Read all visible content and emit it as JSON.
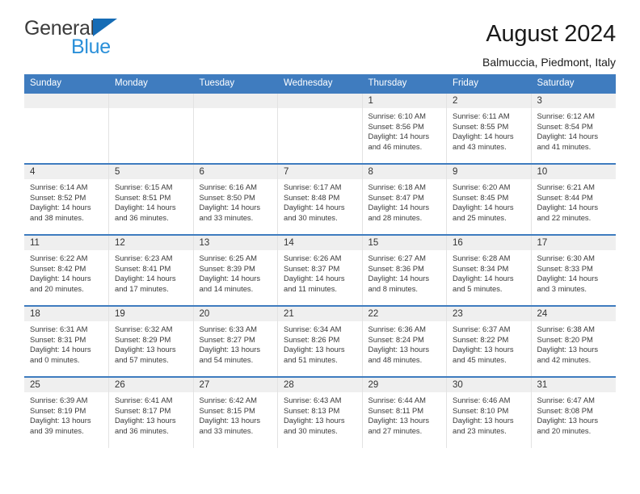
{
  "brand": {
    "line1": "General",
    "line2": "Blue",
    "triangle_color": "#166cb5",
    "blue_color": "#2b90d9"
  },
  "header": {
    "title": "August 2024",
    "subtitle": "Balmuccia, Piedmont, Italy"
  },
  "theme": {
    "header_blue": "#3f7cbf",
    "daynum_bg": "#efefef",
    "text": "#333333"
  },
  "weekdays": [
    "Sunday",
    "Monday",
    "Tuesday",
    "Wednesday",
    "Thursday",
    "Friday",
    "Saturday"
  ],
  "weeks": [
    [
      {
        "day": "",
        "sunrise": "",
        "sunset": "",
        "daylight1": "",
        "daylight2": ""
      },
      {
        "day": "",
        "sunrise": "",
        "sunset": "",
        "daylight1": "",
        "daylight2": ""
      },
      {
        "day": "",
        "sunrise": "",
        "sunset": "",
        "daylight1": "",
        "daylight2": ""
      },
      {
        "day": "",
        "sunrise": "",
        "sunset": "",
        "daylight1": "",
        "daylight2": ""
      },
      {
        "day": "1",
        "sunrise": "Sunrise: 6:10 AM",
        "sunset": "Sunset: 8:56 PM",
        "daylight1": "Daylight: 14 hours",
        "daylight2": "and 46 minutes."
      },
      {
        "day": "2",
        "sunrise": "Sunrise: 6:11 AM",
        "sunset": "Sunset: 8:55 PM",
        "daylight1": "Daylight: 14 hours",
        "daylight2": "and 43 minutes."
      },
      {
        "day": "3",
        "sunrise": "Sunrise: 6:12 AM",
        "sunset": "Sunset: 8:54 PM",
        "daylight1": "Daylight: 14 hours",
        "daylight2": "and 41 minutes."
      }
    ],
    [
      {
        "day": "4",
        "sunrise": "Sunrise: 6:14 AM",
        "sunset": "Sunset: 8:52 PM",
        "daylight1": "Daylight: 14 hours",
        "daylight2": "and 38 minutes."
      },
      {
        "day": "5",
        "sunrise": "Sunrise: 6:15 AM",
        "sunset": "Sunset: 8:51 PM",
        "daylight1": "Daylight: 14 hours",
        "daylight2": "and 36 minutes."
      },
      {
        "day": "6",
        "sunrise": "Sunrise: 6:16 AM",
        "sunset": "Sunset: 8:50 PM",
        "daylight1": "Daylight: 14 hours",
        "daylight2": "and 33 minutes."
      },
      {
        "day": "7",
        "sunrise": "Sunrise: 6:17 AM",
        "sunset": "Sunset: 8:48 PM",
        "daylight1": "Daylight: 14 hours",
        "daylight2": "and 30 minutes."
      },
      {
        "day": "8",
        "sunrise": "Sunrise: 6:18 AM",
        "sunset": "Sunset: 8:47 PM",
        "daylight1": "Daylight: 14 hours",
        "daylight2": "and 28 minutes."
      },
      {
        "day": "9",
        "sunrise": "Sunrise: 6:20 AM",
        "sunset": "Sunset: 8:45 PM",
        "daylight1": "Daylight: 14 hours",
        "daylight2": "and 25 minutes."
      },
      {
        "day": "10",
        "sunrise": "Sunrise: 6:21 AM",
        "sunset": "Sunset: 8:44 PM",
        "daylight1": "Daylight: 14 hours",
        "daylight2": "and 22 minutes."
      }
    ],
    [
      {
        "day": "11",
        "sunrise": "Sunrise: 6:22 AM",
        "sunset": "Sunset: 8:42 PM",
        "daylight1": "Daylight: 14 hours",
        "daylight2": "and 20 minutes."
      },
      {
        "day": "12",
        "sunrise": "Sunrise: 6:23 AM",
        "sunset": "Sunset: 8:41 PM",
        "daylight1": "Daylight: 14 hours",
        "daylight2": "and 17 minutes."
      },
      {
        "day": "13",
        "sunrise": "Sunrise: 6:25 AM",
        "sunset": "Sunset: 8:39 PM",
        "daylight1": "Daylight: 14 hours",
        "daylight2": "and 14 minutes."
      },
      {
        "day": "14",
        "sunrise": "Sunrise: 6:26 AM",
        "sunset": "Sunset: 8:37 PM",
        "daylight1": "Daylight: 14 hours",
        "daylight2": "and 11 minutes."
      },
      {
        "day": "15",
        "sunrise": "Sunrise: 6:27 AM",
        "sunset": "Sunset: 8:36 PM",
        "daylight1": "Daylight: 14 hours",
        "daylight2": "and 8 minutes."
      },
      {
        "day": "16",
        "sunrise": "Sunrise: 6:28 AM",
        "sunset": "Sunset: 8:34 PM",
        "daylight1": "Daylight: 14 hours",
        "daylight2": "and 5 minutes."
      },
      {
        "day": "17",
        "sunrise": "Sunrise: 6:30 AM",
        "sunset": "Sunset: 8:33 PM",
        "daylight1": "Daylight: 14 hours",
        "daylight2": "and 3 minutes."
      }
    ],
    [
      {
        "day": "18",
        "sunrise": "Sunrise: 6:31 AM",
        "sunset": "Sunset: 8:31 PM",
        "daylight1": "Daylight: 14 hours",
        "daylight2": "and 0 minutes."
      },
      {
        "day": "19",
        "sunrise": "Sunrise: 6:32 AM",
        "sunset": "Sunset: 8:29 PM",
        "daylight1": "Daylight: 13 hours",
        "daylight2": "and 57 minutes."
      },
      {
        "day": "20",
        "sunrise": "Sunrise: 6:33 AM",
        "sunset": "Sunset: 8:27 PM",
        "daylight1": "Daylight: 13 hours",
        "daylight2": "and 54 minutes."
      },
      {
        "day": "21",
        "sunrise": "Sunrise: 6:34 AM",
        "sunset": "Sunset: 8:26 PM",
        "daylight1": "Daylight: 13 hours",
        "daylight2": "and 51 minutes."
      },
      {
        "day": "22",
        "sunrise": "Sunrise: 6:36 AM",
        "sunset": "Sunset: 8:24 PM",
        "daylight1": "Daylight: 13 hours",
        "daylight2": "and 48 minutes."
      },
      {
        "day": "23",
        "sunrise": "Sunrise: 6:37 AM",
        "sunset": "Sunset: 8:22 PM",
        "daylight1": "Daylight: 13 hours",
        "daylight2": "and 45 minutes."
      },
      {
        "day": "24",
        "sunrise": "Sunrise: 6:38 AM",
        "sunset": "Sunset: 8:20 PM",
        "daylight1": "Daylight: 13 hours",
        "daylight2": "and 42 minutes."
      }
    ],
    [
      {
        "day": "25",
        "sunrise": "Sunrise: 6:39 AM",
        "sunset": "Sunset: 8:19 PM",
        "daylight1": "Daylight: 13 hours",
        "daylight2": "and 39 minutes."
      },
      {
        "day": "26",
        "sunrise": "Sunrise: 6:41 AM",
        "sunset": "Sunset: 8:17 PM",
        "daylight1": "Daylight: 13 hours",
        "daylight2": "and 36 minutes."
      },
      {
        "day": "27",
        "sunrise": "Sunrise: 6:42 AM",
        "sunset": "Sunset: 8:15 PM",
        "daylight1": "Daylight: 13 hours",
        "daylight2": "and 33 minutes."
      },
      {
        "day": "28",
        "sunrise": "Sunrise: 6:43 AM",
        "sunset": "Sunset: 8:13 PM",
        "daylight1": "Daylight: 13 hours",
        "daylight2": "and 30 minutes."
      },
      {
        "day": "29",
        "sunrise": "Sunrise: 6:44 AM",
        "sunset": "Sunset: 8:11 PM",
        "daylight1": "Daylight: 13 hours",
        "daylight2": "and 27 minutes."
      },
      {
        "day": "30",
        "sunrise": "Sunrise: 6:46 AM",
        "sunset": "Sunset: 8:10 PM",
        "daylight1": "Daylight: 13 hours",
        "daylight2": "and 23 minutes."
      },
      {
        "day": "31",
        "sunrise": "Sunrise: 6:47 AM",
        "sunset": "Sunset: 8:08 PM",
        "daylight1": "Daylight: 13 hours",
        "daylight2": "and 20 minutes."
      }
    ]
  ]
}
